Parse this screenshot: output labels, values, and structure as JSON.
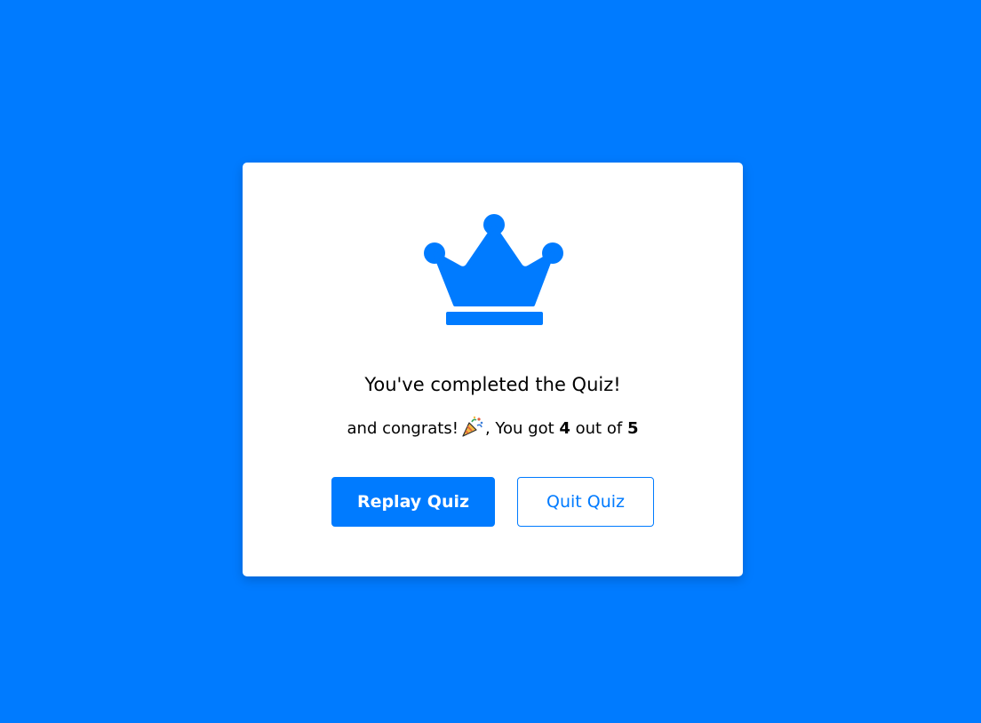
{
  "colors": {
    "background": "#007bff",
    "accent": "#007bff",
    "card": "#ffffff",
    "text": "#000000"
  },
  "result": {
    "icon": "crown-icon",
    "complete_text": "You've completed the Quiz!",
    "score_prefix": "and congrats!",
    "party_icon": "party-popper-icon",
    "score_middle": ", You got",
    "score_correct": "4",
    "score_out_of_text": "out of",
    "score_total": "5"
  },
  "buttons": {
    "replay_label": "Replay Quiz",
    "quit_label": "Quit Quiz"
  }
}
